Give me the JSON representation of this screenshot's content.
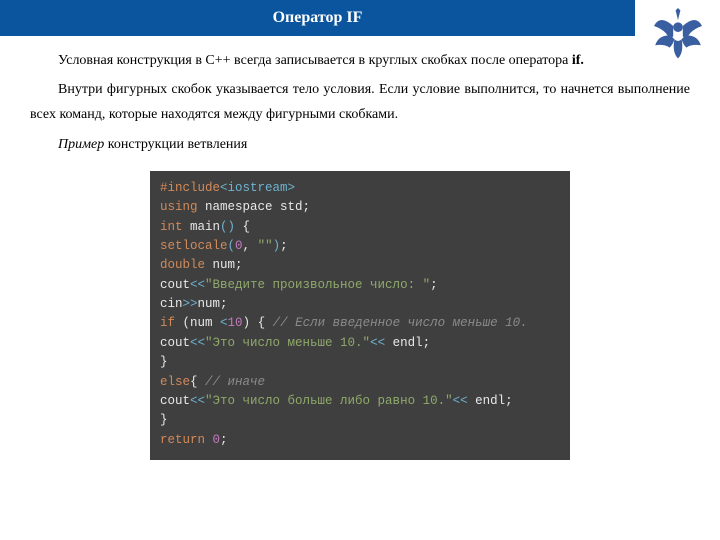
{
  "header": {
    "title": "Оператор IF"
  },
  "paragraphs": {
    "p1_a": "Условная конструкция в С++ всегда записывается в круглых скобках после оператора ",
    "p1_b": "if.",
    "p2": "Внутри фигурных скобок указывается тело условия. Если условие выполнится, то начнется выполнение всех команд, которые находятся между фигурными скобками.",
    "p3_a": "Пример",
    "p3_b": " конструкции ветвления"
  },
  "code": {
    "l1": {
      "a": "#include",
      "b": "<iostream>"
    },
    "l2": {
      "a": "using",
      "b": " namespace std;"
    },
    "l3": {
      "a": "int",
      "b": " main",
      "c": "()",
      "d": " {"
    },
    "l4": {
      "a": "setlocale",
      "b": "(",
      "c": "0",
      "d": ", ",
      "e": "\"\"",
      "f": ")",
      "g": ";"
    },
    "l5": {
      "a": "double",
      "b": " num;"
    },
    "l6": {
      "a": "cout",
      "b": "<<",
      "c": "\"Введите произвольное число: \"",
      "d": ";"
    },
    "l7": {
      "a": "cin",
      "b": ">>",
      "c": "num;"
    },
    "l8": {
      "a": "if",
      "b": " (num ",
      "c": "<",
      "d": "10",
      "e": ") { ",
      "f": "// Если введенное число меньше 10."
    },
    "l9": {
      "a": "cout",
      "b": "<<",
      "c": "\"Это число меньше 10.\"",
      "d": "<<",
      "e": " endl;"
    },
    "l10": {
      "a": "}"
    },
    "l11": {
      "a": "else",
      "b": "{ ",
      "c": "// иначе"
    },
    "l12": {
      "a": "cout",
      "b": "<<",
      "c": "\"Это число больше либо равно 10.\"",
      "d": "<<",
      "e": " endl;"
    },
    "l13": {
      "a": "}"
    },
    "l14": {
      "a": "return ",
      "b": "0",
      "c": ";"
    }
  }
}
